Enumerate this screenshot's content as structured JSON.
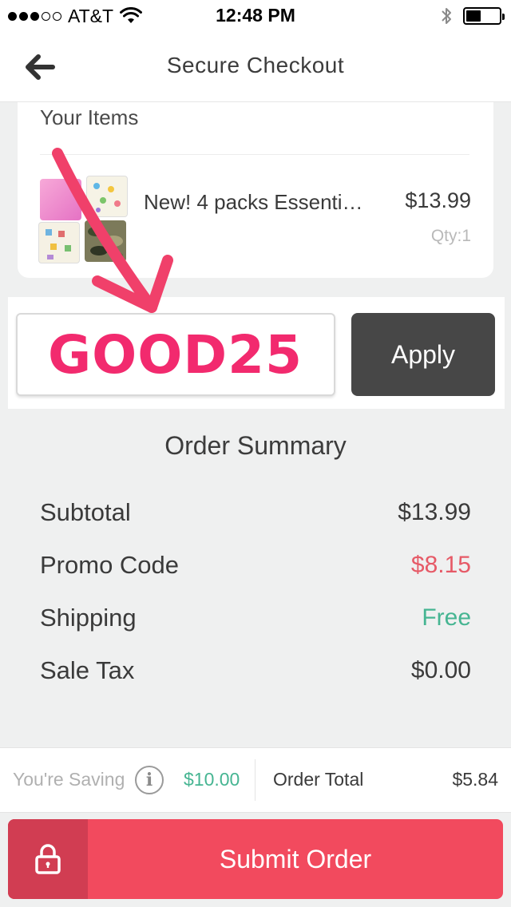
{
  "status_bar": {
    "carrier": "AT&T",
    "time": "12:48 PM",
    "signal_bars_filled": 3,
    "signal_bars_total": 5,
    "battery_level": 0.45
  },
  "nav": {
    "title": "Secure Checkout",
    "back_icon": "back-arrow-icon"
  },
  "items": {
    "heading": "Your Items",
    "list": [
      {
        "name": "New! 4 packs Essenti…",
        "price": "$13.99",
        "qty": "Qty:1"
      }
    ]
  },
  "promo": {
    "code_value": "GOOD25",
    "apply_label": "Apply",
    "annotation_color": "#f0406a"
  },
  "summary": {
    "title": "Order Summary",
    "rows": [
      {
        "label": "Subtotal",
        "value": "$13.99"
      },
      {
        "label": "Promo Code",
        "value": "$8.15"
      },
      {
        "label": "Shipping",
        "value": "Free"
      },
      {
        "label": "Sale Tax",
        "value": "$0.00"
      }
    ]
  },
  "totals": {
    "saving_label": "You're Saving",
    "saving_amount": "$10.00",
    "order_total_label": "Order Total",
    "order_total_value": "$5.84"
  },
  "submit": {
    "label": "Submit Order",
    "icon": "lock-icon"
  },
  "colors": {
    "accent": "#f24a5e",
    "promo_red": "#e65a67",
    "green": "#46b592",
    "apply_bg": "#474747",
    "background": "#eff0f0"
  }
}
